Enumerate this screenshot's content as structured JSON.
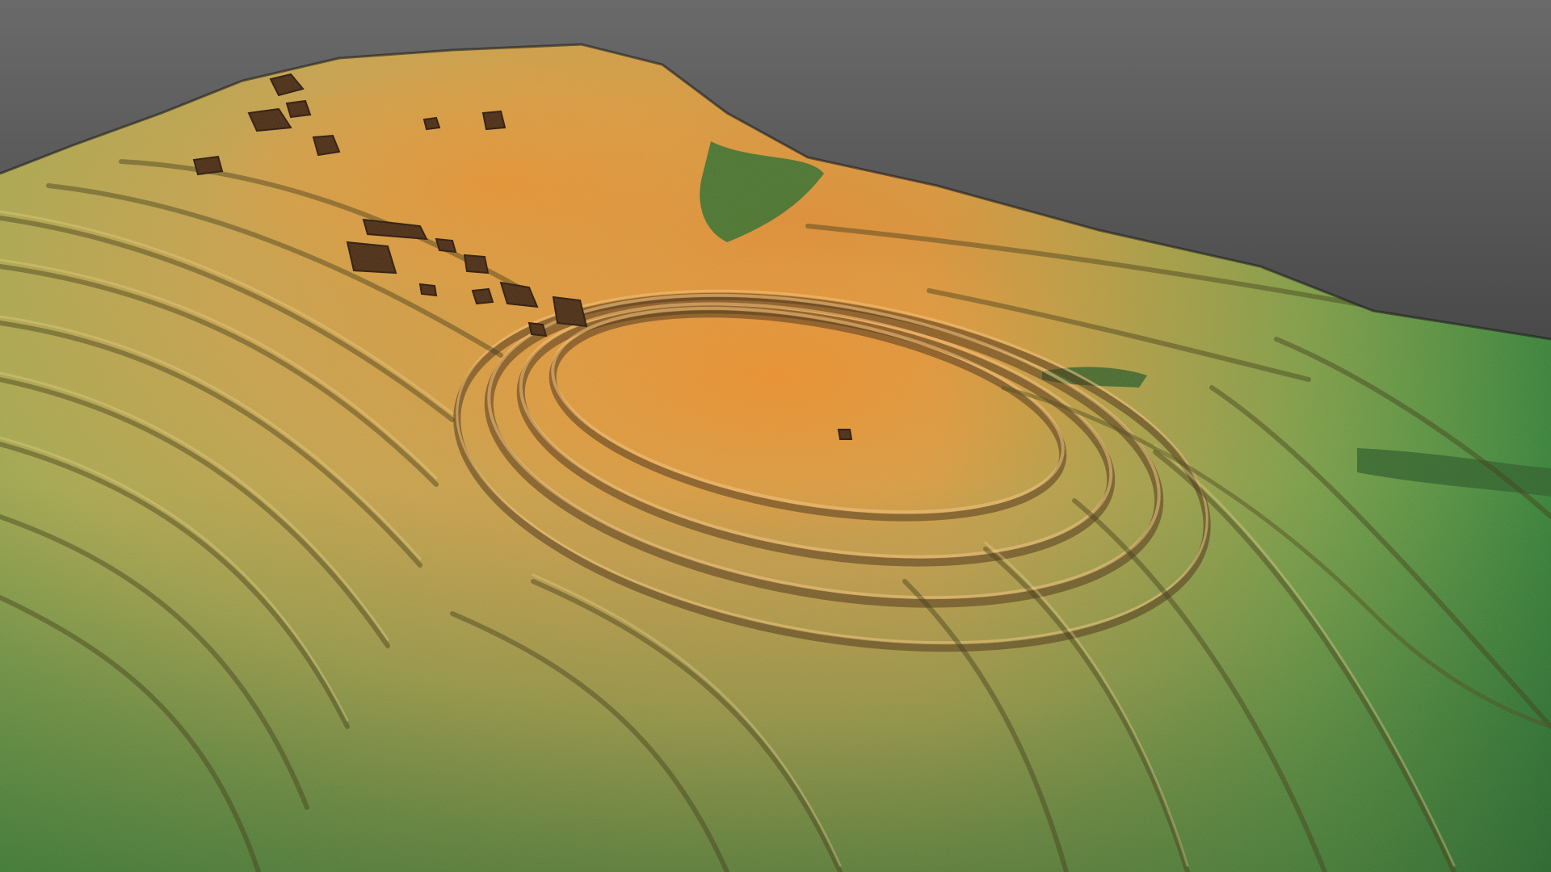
{
  "scene": {
    "subject": "lidar-terrain-relief",
    "palette": {
      "background_top": "#6a6a6a",
      "background_bottom": "#262626",
      "summit_orange": "#e2892e",
      "mid_ochre": "#c9a24a",
      "low_yellow_green": "#a9a84c",
      "edge_green": "#4f9a3f",
      "dark_green": "#2f6f2a",
      "shadow_brown": "#4a2f12"
    }
  }
}
